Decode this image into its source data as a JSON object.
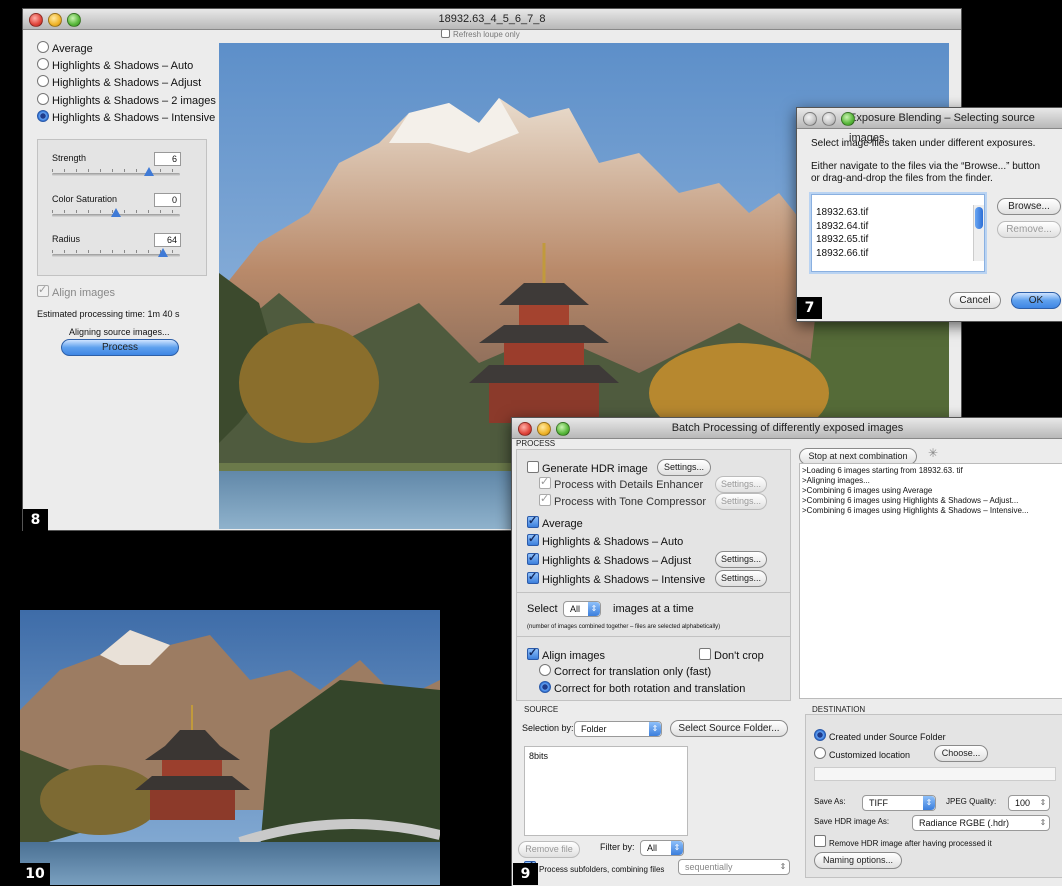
{
  "main_window": {
    "title": "18932.63_4_5_6_7_8",
    "refresh_loupe_label": "Refresh loupe only",
    "methods": [
      "Average",
      "Highlights & Shadows – Auto",
      "Highlights & Shadows – Adjust",
      "Highlights & Shadows – 2 images",
      "Highlights & Shadows – Intensive"
    ],
    "selected_method_index": 4,
    "sliders": [
      {
        "label": "Strength",
        "value": "6",
        "level": 0.85
      },
      {
        "label": "Color Saturation",
        "value": "0",
        "level": 0.5
      },
      {
        "label": "Radius",
        "value": "64",
        "level": 0.9
      }
    ],
    "align_images_label": "Align images",
    "estimated_time": "Estimated processing time:  1m  40 s",
    "status": "Aligning source images...",
    "process_button": "Process",
    "badge": "8"
  },
  "exposure_dialog": {
    "title": "Exposure Blending – Selecting source images",
    "line1": "Select image files taken under different exposures.",
    "line2": "Either navigate to the files via the “Browse...” button",
    "line3": "or drag-and-drop the files from the finder.",
    "files": [
      "18932.63.tif",
      "18932.64.tif",
      "18932.65.tif",
      "18932.66.tif"
    ],
    "browse": "Browse...",
    "remove": "Remove...",
    "cancel": "Cancel",
    "ok": "OK",
    "badge": "7"
  },
  "batch_window": {
    "title": "Batch Processing of differently exposed images",
    "process_header": "PROCESS",
    "generate_hdr": "Generate HDR image",
    "settings": "Settings...",
    "details_enhancer": "Process with Details Enhancer",
    "tone_compressor": "Process with Tone Compressor",
    "average": "Average",
    "hs_auto": "Highlights & Shadows – Auto",
    "hs_adjust": "Highlights & Shadows – Adjust",
    "hs_intensive": "Highlights & Shadows – Intensive",
    "select_label": "Select",
    "select_value": "All",
    "images_at_time": "images at a time",
    "note": "(number of images combined together – files are selected alphabetically)",
    "align_images": "Align images",
    "dont_crop": "Don't crop",
    "translation_only": "Correct for translation only (fast)",
    "rotation_translation": "Correct for both rotation and translation",
    "stop_button": "Stop at next combination",
    "log": [
      ">Loading 6 images starting from 18932.63. tif",
      ">Aligning images...",
      ">Combining 6 images using Average",
      ">Combining 6 images using Highlights & Shadows – Adjust...",
      ">Combining 6 images using Highlights & Shadows – Intensive..."
    ],
    "source_header": "SOURCE",
    "selection_by": "Selection by:",
    "selection_value": "Folder",
    "select_source_folder": "Select Source Folder...",
    "source_item": "8bits",
    "remove_file": "Remove file",
    "filter_by": "Filter by:",
    "filter_value": "All",
    "process_subfolders": "Process subfolders, combining files",
    "subfolder_mode": "sequentially",
    "destination_header": "DESTINATION",
    "created_under": "Created under Source Folder",
    "customized": "Customized location",
    "choose": "Choose...",
    "save_as": "Save As:",
    "save_as_value": "TIFF",
    "jpeg_quality": "JPEG Quality:",
    "jpeg_value": "100",
    "save_hdr_as": "Save HDR image As:",
    "save_hdr_value": "Radiance RGBE (.hdr)",
    "remove_hdr": "Remove HDR image after having processed it",
    "naming_options": "Naming options...",
    "badge": "9"
  },
  "hdr_result": {
    "badge": "10"
  },
  "colors": {
    "accent": "#3f86e4",
    "window_bg": "#ececec",
    "sky": "#7fa9d6"
  }
}
